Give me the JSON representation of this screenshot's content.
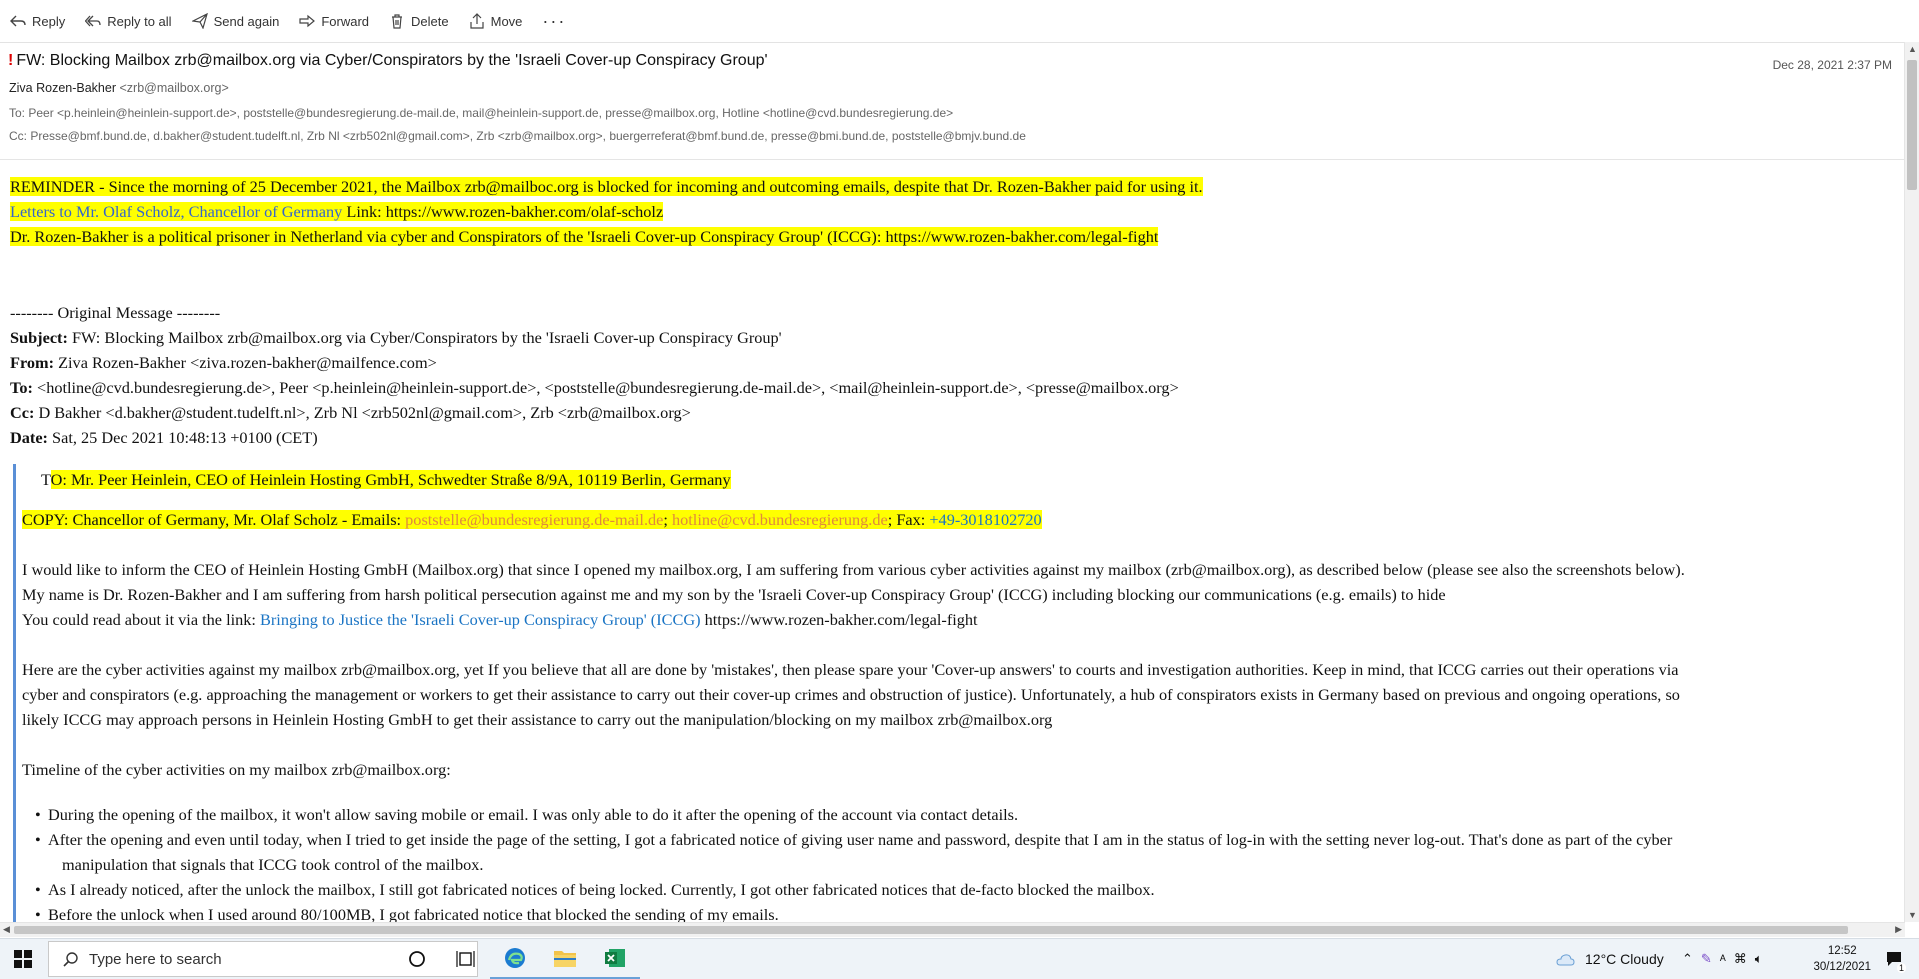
{
  "toolbar": {
    "reply": "Reply",
    "reply_all": "Reply to all",
    "send_again": "Send again",
    "forward": "Forward",
    "delete": "Delete",
    "move": "Move",
    "more": "···"
  },
  "email": {
    "importance": "!",
    "subject": "FW: Blocking Mailbox zrb@mailbox.org via Cyber/Conspirators by the 'Israeli Cover-up Conspiracy Group'",
    "date": "Dec 28, 2021 2:37 PM",
    "from_name": "Ziva Rozen-Bakher",
    "from_addr": "<zrb@mailbox.org>",
    "to": "To: Peer <p.heinlein@heinlein-support.de>, poststelle@bundesregierung.de-mail.de, mail@heinlein-support.de, presse@mailbox.org, Hotline <hotline@cvd.bundesregierung.de>",
    "cc": "Cc: Presse@bmf.bund.de, d.bakher@student.tudelft.nl, Zrb Nl <zrb502nl@gmail.com>, Zrb <zrb@mailbox.org>, buergerreferat@bmf.bund.de, presse@bmi.bund.de, poststelle@bmjv.bund.de"
  },
  "body": {
    "reminder": "REMINDER - Since the morning of 25 December 2021, the Mailbox zrb@mailboc.org is blocked for incoming and outcoming emails, despite that Dr. Rozen-Bakher paid for using it.",
    "letters_link": "Letters to Mr. Olaf Scholz, Chancellor of Germany",
    "letters_url": " Link: https://www.rozen-bakher.com/olaf-scholz",
    "prisoner": "Dr. Rozen-Bakher is a political prisoner in Netherland via cyber and Conspirators of the 'Israeli Cover-up Conspiracy Group' (ICCG): https://www.rozen-bakher.com/legal-fight",
    "orig_header": "-------- Original Message --------",
    "subject_label": "Subject:",
    "subject_value": " FW: Blocking Mailbox zrb@mailbox.org via Cyber/Conspirators by the 'Israeli Cover-up Conspiracy Group'",
    "from_label": "From:",
    "from_value": " Ziva Rozen-Bakher <ziva.rozen-bakher@mailfence.com>",
    "to_label": "To:",
    "to_value": " <hotline@cvd.bundesregierung.de>, Peer <p.heinlein@heinlein-support.de>, <poststelle@bundesregierung.de-mail.de>, <mail@heinlein-support.de>, <presse@mailbox.org>",
    "cc_label": "Cc:",
    "cc_value": " D Bakher <d.bakher@student.tudelft.nl>, Zrb Nl <zrb502nl@gmail.com>, Zrb <zrb@mailbox.org>",
    "date_label": "Date:",
    "date_value": " Sat, 25 Dec 2021 10:48:13 +0100 (CET)",
    "to_ceo_t": "T",
    "to_ceo": "O: Mr. Peer Heinlein, CEO of Heinlein Hosting GmbH, Schwedter Straße 8/9A, 10119 Berlin, Germany",
    "copy_prefix": "COPY: Chancellor of Germany, Mr. Olaf Scholz - Emails: ",
    "copy_email1": "poststelle@bundesregierung.de-mail.de",
    "copy_sep": "; ",
    "copy_email2": "hotline@cvd.bundesregierung.de",
    "copy_fax_label": "; Fax: ",
    "copy_fax": "+49-3018102720",
    "p1_l1": "I would like to inform the CEO of  Heinlein Hosting GmbH (Mailbox.org) that since I opened my mailbox.org, I am suffering from various cyber activities against my mailbox (zrb@mailbox.org), as described below (please see also the screenshots below).",
    "p1_l2": "My name is Dr. Rozen-Bakher and I am suffering from harsh political persecution against me and my son by the 'Israeli Cover-up Conspiracy Group' (ICCG) including blocking our communications (e.g. emails) to hide",
    "p1_l3_pre": "You could read about it via the link: ",
    "p1_l3_link": "Bringing to Justice the 'Israeli Cover-up Conspiracy Group' (ICCG)",
    "p1_l3_post": " https://www.rozen-bakher.com/legal-fight",
    "p2_l1": "Here are the cyber activities against my mailbox zrb@mailbox.org, yet If you believe that all are done by 'mistakes', then please spare your 'Cover-up answers' to courts and investigation authorities. Keep in mind, that ICCG carries out their operations via",
    "p2_l2": "cyber and conspirators (e.g. approaching the management or workers to get their assistance to carry out their cover-up crimes and obstruction of justice). Unfortunately, a hub of conspirators exists in Germany based on previous and ongoing operations, so",
    "p2_l3": "likely ICCG may approach persons in Heinlein Hosting GmbH to get their assistance to carry out the manipulation/blocking on my mailbox zrb@mailbox.org",
    "timeline": "Timeline of the cyber activities on my mailbox zrb@mailbox.org:",
    "b1": "During the opening of the mailbox, it won't allow saving mobile or email.  I was only able to do it after the opening of the account via contact details.",
    "b2_l1": "After the opening and even until today, when I tried to get inside the page of the setting, I got a fabricated notice of giving user name and password, despite that I am in the status of log-in with the setting never log-out. That's done as part of the cyber",
    "b2_l2": "manipulation that signals that ICCG took control of the mailbox.",
    "b3": "As I already noticed, after the unlock the mailbox, I still got fabricated notices of being locked. Currently, I got other fabricated notices that de-facto blocked the mailbox.",
    "b4": "Before the unlock when I used around 80/100MB, I got fabricated notice that blocked the sending of my emails."
  },
  "taskbar": {
    "search_placeholder": "Type here to search",
    "weather": "12°C  Cloudy",
    "time": "12:52",
    "date": "30/12/2021",
    "notif_count": "1"
  }
}
